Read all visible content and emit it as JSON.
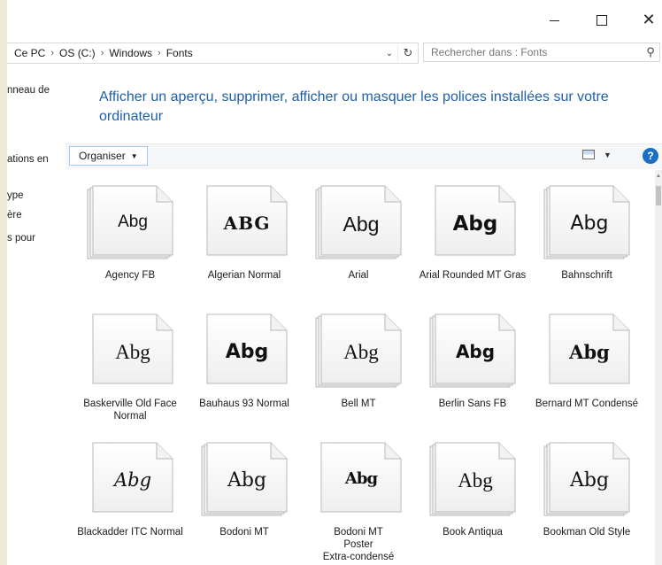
{
  "window": {
    "minimize_glyph": "–",
    "close_glyph": "✕"
  },
  "address": {
    "crumbs": [
      "Ce PC",
      "OS (C:)",
      "Windows",
      "Fonts"
    ],
    "separator": "›"
  },
  "search": {
    "placeholder": "Rechercher dans : Fonts"
  },
  "left_pane": {
    "items": [
      "nneau de",
      "ations en",
      "ype",
      "ère",
      "s pour"
    ]
  },
  "page": {
    "heading": "Afficher un aperçu, supprimer, afficher ou masquer les polices installées sur votre ordinateur"
  },
  "toolbar": {
    "organise_label": "Organiser",
    "help_label": "?"
  },
  "fonts": [
    {
      "name": "Agency FB",
      "sample": "Abg",
      "stacked": true,
      "style": "agency"
    },
    {
      "name": "Algerian Normal",
      "sample": "ABG",
      "stacked": false,
      "style": "algerian"
    },
    {
      "name": "Arial",
      "sample": "Abg",
      "stacked": true,
      "style": "arial"
    },
    {
      "name": "Arial Rounded MT Gras",
      "sample": "Abg",
      "stacked": false,
      "style": "arialrounded"
    },
    {
      "name": "Bahnschrift",
      "sample": "Abg",
      "stacked": true,
      "style": "bahn"
    },
    {
      "name": "Baskerville Old Face Normal",
      "sample": "Abg",
      "stacked": false,
      "style": "serif"
    },
    {
      "name": "Bauhaus 93 Normal",
      "sample": "Abg",
      "stacked": false,
      "style": "bauhaus"
    },
    {
      "name": "Bell MT",
      "sample": "Abg",
      "stacked": true,
      "style": "serif"
    },
    {
      "name": "Berlin Sans FB",
      "sample": "Abg",
      "stacked": true,
      "style": "berlin"
    },
    {
      "name": "Bernard MT Condensé",
      "sample": "Abg",
      "stacked": false,
      "style": "bernard"
    },
    {
      "name": "Blackadder ITC Normal",
      "sample": "Abg",
      "stacked": false,
      "style": "script"
    },
    {
      "name": "Bodoni MT",
      "sample": "Abg",
      "stacked": true,
      "style": "bodoni"
    },
    {
      "name": "Bodoni MT Poster Extra-condensé",
      "sample": "Abg",
      "stacked": false,
      "style": "poster"
    },
    {
      "name": "Book Antiqua",
      "sample": "Abg",
      "stacked": true,
      "style": "serif"
    },
    {
      "name": "Bookman Old Style",
      "sample": "Abg",
      "stacked": true,
      "style": "bookman"
    }
  ]
}
